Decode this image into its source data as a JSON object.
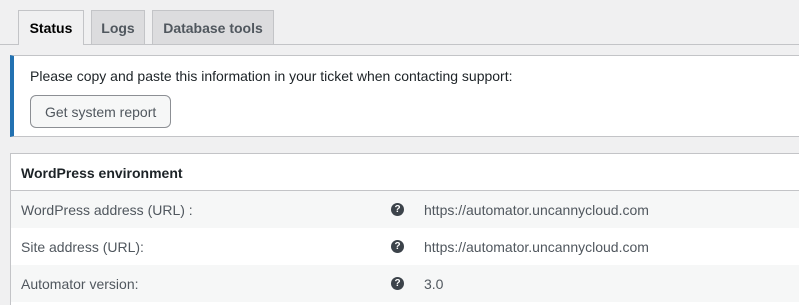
{
  "tabs": [
    {
      "label": "Status",
      "active": true
    },
    {
      "label": "Logs",
      "active": false
    },
    {
      "label": "Database tools",
      "active": false
    }
  ],
  "notice": {
    "text": "Please copy and paste this information in your ticket when contacting support:",
    "button_label": "Get system report",
    "accent_color": "#2271b1"
  },
  "table": {
    "heading": "WordPress environment",
    "rows": [
      {
        "label": "WordPress address (URL) :",
        "help_icon": "question-circle-icon",
        "value": "https://automator.uncannycloud.com"
      },
      {
        "label": "Site address (URL):",
        "help_icon": "question-circle-icon",
        "value": "https://automator.uncannycloud.com"
      },
      {
        "label": "Automator version:",
        "help_icon": "question-circle-icon",
        "value": "3.0"
      }
    ]
  }
}
